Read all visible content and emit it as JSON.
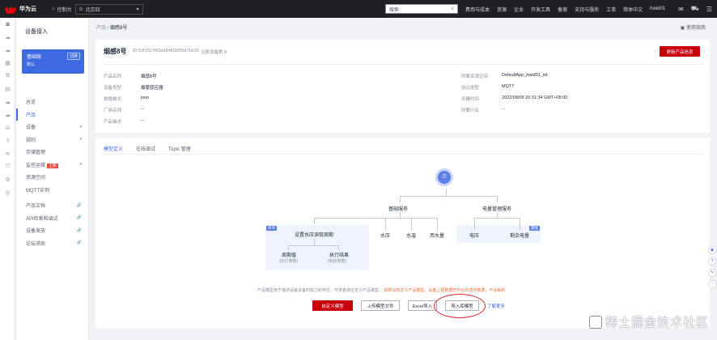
{
  "topbar": {
    "brand": "华为云",
    "console": "控制台",
    "region": "北京四",
    "search_placeholder": "搜索",
    "nav": [
      "费用与成本",
      "资源",
      "企业",
      "开发工具",
      "备案",
      "支持与服务",
      "工单",
      "简体中文",
      "hwid01"
    ]
  },
  "sidebar": {
    "title": "设备接入",
    "instance_name": "基础版",
    "instance_sub": "默认",
    "switch_label": "切换",
    "items": [
      {
        "label": "总览",
        "active": false,
        "arrow": "",
        "badge": ""
      },
      {
        "label": "产品",
        "active": true,
        "arrow": "",
        "badge": ""
      },
      {
        "label": "设备",
        "active": false,
        "arrow": "▾",
        "badge": ""
      },
      {
        "label": "规则",
        "active": false,
        "arrow": "▾",
        "badge": ""
      },
      {
        "label": "存储管理",
        "active": false,
        "arrow": "",
        "badge": ""
      },
      {
        "label": "监控运维",
        "active": false,
        "arrow": "▾",
        "badge": "上新"
      },
      {
        "label": "资源空间",
        "active": false,
        "arrow": "",
        "badge": ""
      },
      {
        "label": "MQTT实例",
        "active": false,
        "arrow": "",
        "badge": ""
      },
      {
        "label": "产品文档",
        "active": false,
        "arrow": "🔗",
        "badge": ""
      },
      {
        "label": "API检索和调试",
        "active": false,
        "arrow": "🔗",
        "badge": ""
      },
      {
        "label": "设备发放",
        "active": false,
        "arrow": "🔗",
        "badge": ""
      },
      {
        "label": "论坛求助",
        "active": false,
        "arrow": "🔗",
        "badge": ""
      }
    ]
  },
  "breadcrumb": {
    "root": "产品",
    "current": "烟感8号"
  },
  "doc_link": "使用指南",
  "product": {
    "name": "烟感8号",
    "id_label": "ID",
    "id": "62f1527f63a684835f0587b216",
    "device_count_label": "注册设备数",
    "device_count": "8",
    "update_button": "更新产品信息",
    "left_fields": [
      {
        "k": "产品名称",
        "v": "烟感8号"
      },
      {
        "k": "设备类型",
        "v": "烟雾感应器"
      },
      {
        "k": "数据格式",
        "v": "json"
      },
      {
        "k": "厂商名称",
        "v": "--"
      },
      {
        "k": "产品描述",
        "v": "--"
      }
    ],
    "right_fields": [
      {
        "k": "所属资源空间",
        "v": "DefaultApp_hwid01_iot"
      },
      {
        "k": "协议类型",
        "v": "MQTT"
      },
      {
        "k": "创建时间",
        "v": "2022/08/08 20:31:34 GMT+08:00"
      },
      {
        "k": "所属行业",
        "v": "--"
      }
    ]
  },
  "tabs": [
    {
      "label": "模型定义",
      "active": true
    },
    {
      "label": "在线调试",
      "active": false
    },
    {
      "label": "Topic 管理",
      "active": false
    }
  ],
  "diagram": {
    "svc1": "基础服务",
    "svc2": "电量管理服务",
    "props1": [
      "水压",
      "水温",
      "用水量"
    ],
    "props2": [
      "电压",
      "剩余电量"
    ],
    "cmd": "设置水压读取周期",
    "cmd_children": [
      {
        "title": "周期值",
        "sub": "(执行参数)"
      },
      {
        "title": "执行结果",
        "sub": "(响应参数)"
      }
    ],
    "tag_cmd": "命令",
    "tag_prop": "属性"
  },
  "description": {
    "text": "产品模型用于描述设备具备的能力和特性，开发者通过定义产品模型，",
    "warn": "如果没有定义产品模型，设备上报数据时平台仅透传数据，不会解析"
  },
  "actions": {
    "custom": "自定义模型",
    "upload": "上传模型文件",
    "excel": "Excel导入",
    "library": "导入库模型",
    "more": "了解更多"
  },
  "watermark": "稀土掘金技术社区",
  "colors": {
    "brand_red": "#c7000b",
    "accent_blue": "#3e6ae1",
    "topbar": "#1f2024"
  }
}
